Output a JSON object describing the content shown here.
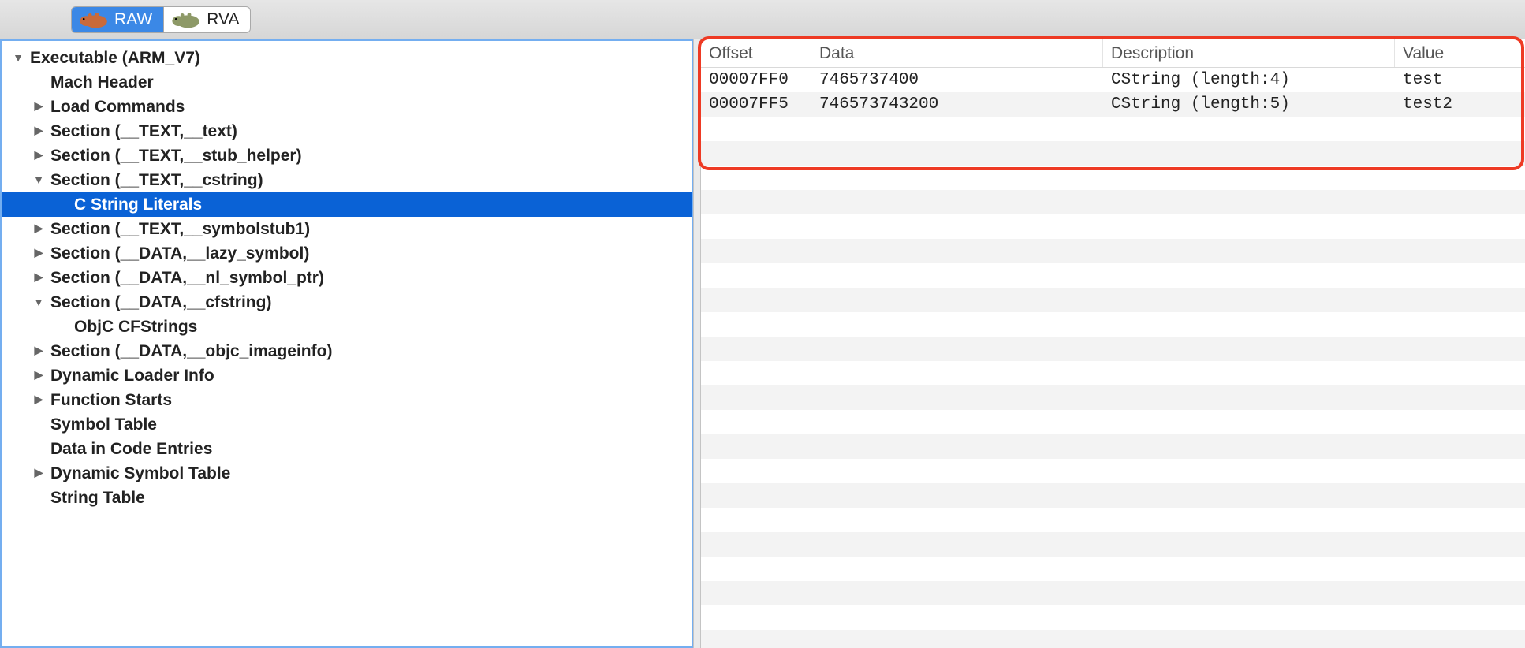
{
  "toolbar": {
    "segments": [
      {
        "label": "RAW",
        "icon": "hippo-icon",
        "active": true
      },
      {
        "label": "RVA",
        "icon": "hippo-icon",
        "active": false
      }
    ]
  },
  "tree": [
    {
      "label": "Executable (ARM_V7)",
      "indent": 0,
      "arrow": "down"
    },
    {
      "label": "Mach Header",
      "indent": 1,
      "arrow": "none"
    },
    {
      "label": "Load Commands",
      "indent": 1,
      "arrow": "right"
    },
    {
      "label": "Section (__TEXT,__text)",
      "indent": 1,
      "arrow": "right"
    },
    {
      "label": "Section (__TEXT,__stub_helper)",
      "indent": 1,
      "arrow": "right"
    },
    {
      "label": "Section (__TEXT,__cstring)",
      "indent": 1,
      "arrow": "down"
    },
    {
      "label": "C String Literals",
      "indent": 2,
      "arrow": "none",
      "selected": true
    },
    {
      "label": "Section (__TEXT,__symbolstub1)",
      "indent": 1,
      "arrow": "right"
    },
    {
      "label": "Section (__DATA,__lazy_symbol)",
      "indent": 1,
      "arrow": "right"
    },
    {
      "label": "Section (__DATA,__nl_symbol_ptr)",
      "indent": 1,
      "arrow": "right"
    },
    {
      "label": "Section (__DATA,__cfstring)",
      "indent": 1,
      "arrow": "down"
    },
    {
      "label": "ObjC CFStrings",
      "indent": 2,
      "arrow": "none"
    },
    {
      "label": "Section (__DATA,__objc_imageinfo)",
      "indent": 1,
      "arrow": "right"
    },
    {
      "label": "Dynamic Loader Info",
      "indent": 1,
      "arrow": "right"
    },
    {
      "label": "Function Starts",
      "indent": 1,
      "arrow": "right"
    },
    {
      "label": "Symbol Table",
      "indent": 1,
      "arrow": "none"
    },
    {
      "label": "Data in Code Entries",
      "indent": 1,
      "arrow": "none"
    },
    {
      "label": "Dynamic Symbol Table",
      "indent": 1,
      "arrow": "right"
    },
    {
      "label": "String Table",
      "indent": 1,
      "arrow": "none"
    }
  ],
  "table": {
    "headers": {
      "offset": "Offset",
      "data": "Data",
      "description": "Description",
      "value": "Value"
    },
    "rows": [
      {
        "offset": "00007FF0",
        "data": "7465737400",
        "description": "CString (length:4)",
        "value": "test"
      },
      {
        "offset": "00007FF5",
        "data": "746573743200",
        "description": "CString (length:5)",
        "value": "test2"
      }
    ],
    "blank_rows": 22
  }
}
